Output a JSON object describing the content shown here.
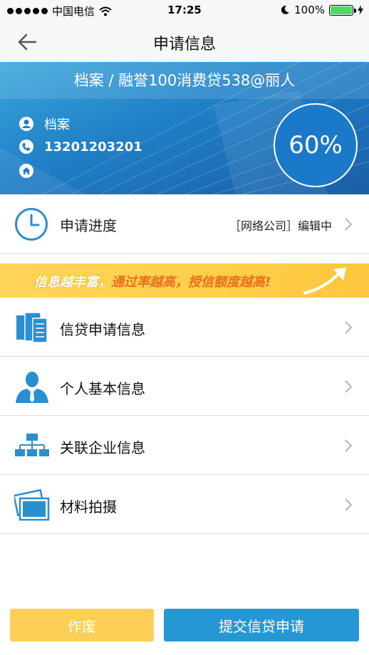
{
  "status_bar": {
    "carrier": "中国电信",
    "time": "17:25",
    "battery": "100%",
    "battery_level": 1.0
  },
  "nav": {
    "title": "申请信息"
  },
  "banner": {
    "title": "档案 / 融誉100消费贷538@丽人",
    "name": "档案",
    "phone": "13201203201",
    "home": "",
    "progress_percent": "60%",
    "progress_value": 0.6
  },
  "progress": {
    "label": "申请进度",
    "status": "［网络公司］编辑中"
  },
  "promo": {
    "part1": "信息越丰富，",
    "part2": "通过率越高，授信额度越高!"
  },
  "items": [
    {
      "label": "信贷申请信息",
      "icon": "document-stack-icon"
    },
    {
      "label": "个人基本信息",
      "icon": "person-icon"
    },
    {
      "label": "关联企业信息",
      "icon": "org-chart-icon"
    },
    {
      "label": "材料拍摄",
      "icon": "photo-icon"
    }
  ],
  "buttons": {
    "void": "作废",
    "submit": "提交信贷申请"
  },
  "colors": {
    "accent": "#2598d4",
    "yellow": "#fecf56",
    "orange": "#e8701a"
  }
}
